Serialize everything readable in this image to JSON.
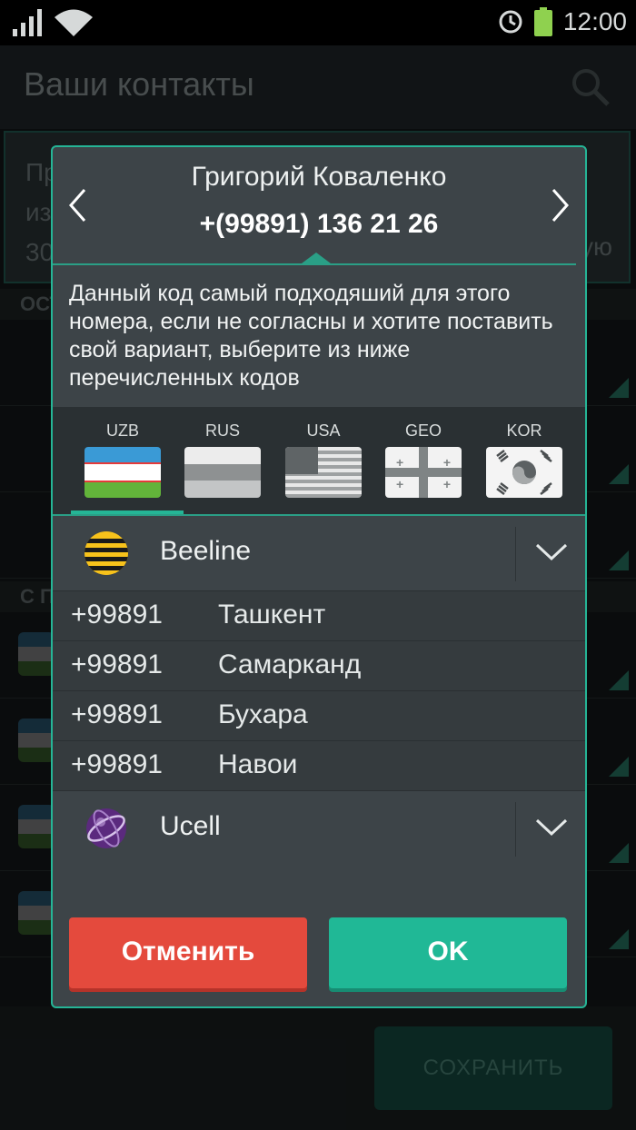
{
  "status_bar": {
    "time": "12:00"
  },
  "app": {
    "title": "Ваши контакты",
    "banner_lines": [
      "Пр",
      "из",
      "30"
    ],
    "banner_tail": "ую",
    "section_one": "ОСТ",
    "section_two": "С П",
    "save_label": "СОХРАНИТЬ"
  },
  "dialog": {
    "contact_name": "Григорий Коваленко",
    "phone": "+(99891) 136 21 26",
    "description": "Данный код самый подходяший для этого номера, если не согласны и хотите поставить свой вариант, выберите из ниже перечисленных кодов",
    "countries": [
      {
        "code": "UZB",
        "selected": true
      },
      {
        "code": "RUS",
        "selected": false
      },
      {
        "code": "USA",
        "selected": false
      },
      {
        "code": "GEO",
        "selected": false
      },
      {
        "code": "KOR",
        "selected": false
      }
    ],
    "operators": [
      {
        "name": "Beeline",
        "logo": "beeline-logo",
        "expanded": true,
        "codes": [
          {
            "code": "+99891",
            "city": "Ташкент"
          },
          {
            "code": "+99891",
            "city": "Самарканд"
          },
          {
            "code": "+99891",
            "city": "Бухара"
          },
          {
            "code": "+99891",
            "city": "Навои"
          }
        ]
      },
      {
        "name": "Ucell",
        "logo": "ucell-logo",
        "expanded": false
      }
    ],
    "cancel_label": "Отменить",
    "ok_label": "OK"
  },
  "colors": {
    "accent": "#25b596",
    "cancel": "#e44a3d",
    "ok": "#20b896",
    "dialog_bg": "#3d4448"
  }
}
